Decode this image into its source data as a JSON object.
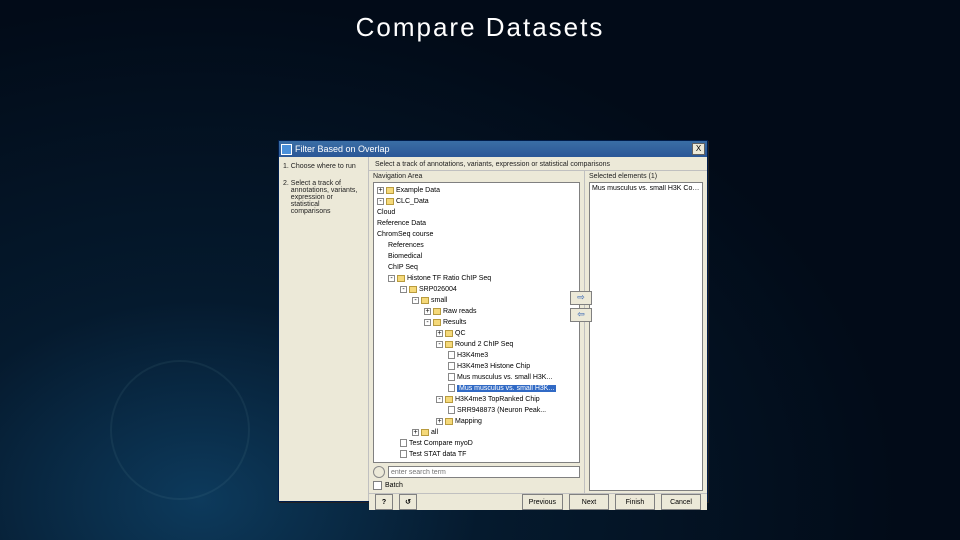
{
  "slide": {
    "title": "Compare Datasets"
  },
  "window": {
    "title": "Filter Based on Overlap",
    "close": "X"
  },
  "left": {
    "step1_num": "1.",
    "step1_txt": "Choose where to run",
    "step2_num": "2.",
    "step2_txt": "Select a track of annotations, variants, expression or statistical comparisons"
  },
  "main": {
    "instruction": "Select a track of annotations, variants, expression or statistical comparisons",
    "nav_label": "Navigation Area",
    "detail_label": "Batch",
    "search_placeholder": "enter search term"
  },
  "tree": {
    "n0": "Example Data",
    "n1": "CLC_Data",
    "n2": "Cloud",
    "n3": "Reference Data",
    "n4": "ChromSeq course",
    "n5": "References",
    "n6": "Biomedical",
    "n7": "ChIP Seq",
    "n8": "Histone TF Ratio ChIP Seq",
    "n9": "SRP026004",
    "n10": "small",
    "n11": "Raw reads",
    "n12": "Results",
    "n13": "QC",
    "n14": "Round 2 ChIP Seq",
    "n15": "H3K4me3",
    "n16": "H3K4me3 Histone Chip",
    "n17": "Mus musculus vs. small H3K...",
    "n17b": "Mus musculus vs. small H3K...",
    "n18": "H3K4me3 TopRanked Chip",
    "n19": "SRR948873 (Neuron Peak...",
    "n20": "Mapping",
    "n21": "all",
    "n22": "Test Compare myoD",
    "n23": "Test STAT data TF"
  },
  "right": {
    "label": "Selected elements (1)",
    "item1": "Mus musculus vs. small H3K Con..."
  },
  "movebtns": {
    "add": "⇨",
    "remove": "⇦"
  },
  "footer": {
    "help": "?",
    "reset": "↺",
    "prev": "Previous",
    "next": "Next",
    "finish": "Finish",
    "cancel": "Cancel"
  }
}
